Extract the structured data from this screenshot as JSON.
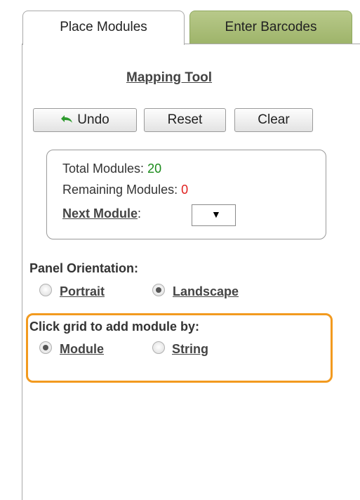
{
  "tabs": [
    {
      "label": "Place Modules",
      "active": true
    },
    {
      "label": "Enter Barcodes",
      "active": false
    }
  ],
  "title": "Mapping Tool",
  "buttons": {
    "undo": "Undo",
    "reset": "Reset",
    "clear": "Clear"
  },
  "info": {
    "total_label": "Total Modules: ",
    "total_value": "20",
    "remaining_label": "Remaining Modules: ",
    "remaining_value": "0",
    "next_label": "Next Module",
    "next_colon": ":",
    "next_value": ""
  },
  "orientation": {
    "label": "Panel Orientation:",
    "options": [
      {
        "label": "Portrait",
        "checked": false
      },
      {
        "label": "Landscape",
        "checked": true
      }
    ]
  },
  "add_by": {
    "label": "Click grid to add module by:",
    "options": [
      {
        "label": "Module",
        "checked": true
      },
      {
        "label": "String",
        "checked": false
      }
    ]
  },
  "colors": {
    "accent_highlight": "#f29a1f",
    "value_green": "#1a8a1a",
    "value_red": "#e0201e",
    "inactive_tab": "#a8bd78"
  },
  "icons": {
    "undo": "undo-arrow-icon",
    "dropdown": "caret-down-icon"
  }
}
